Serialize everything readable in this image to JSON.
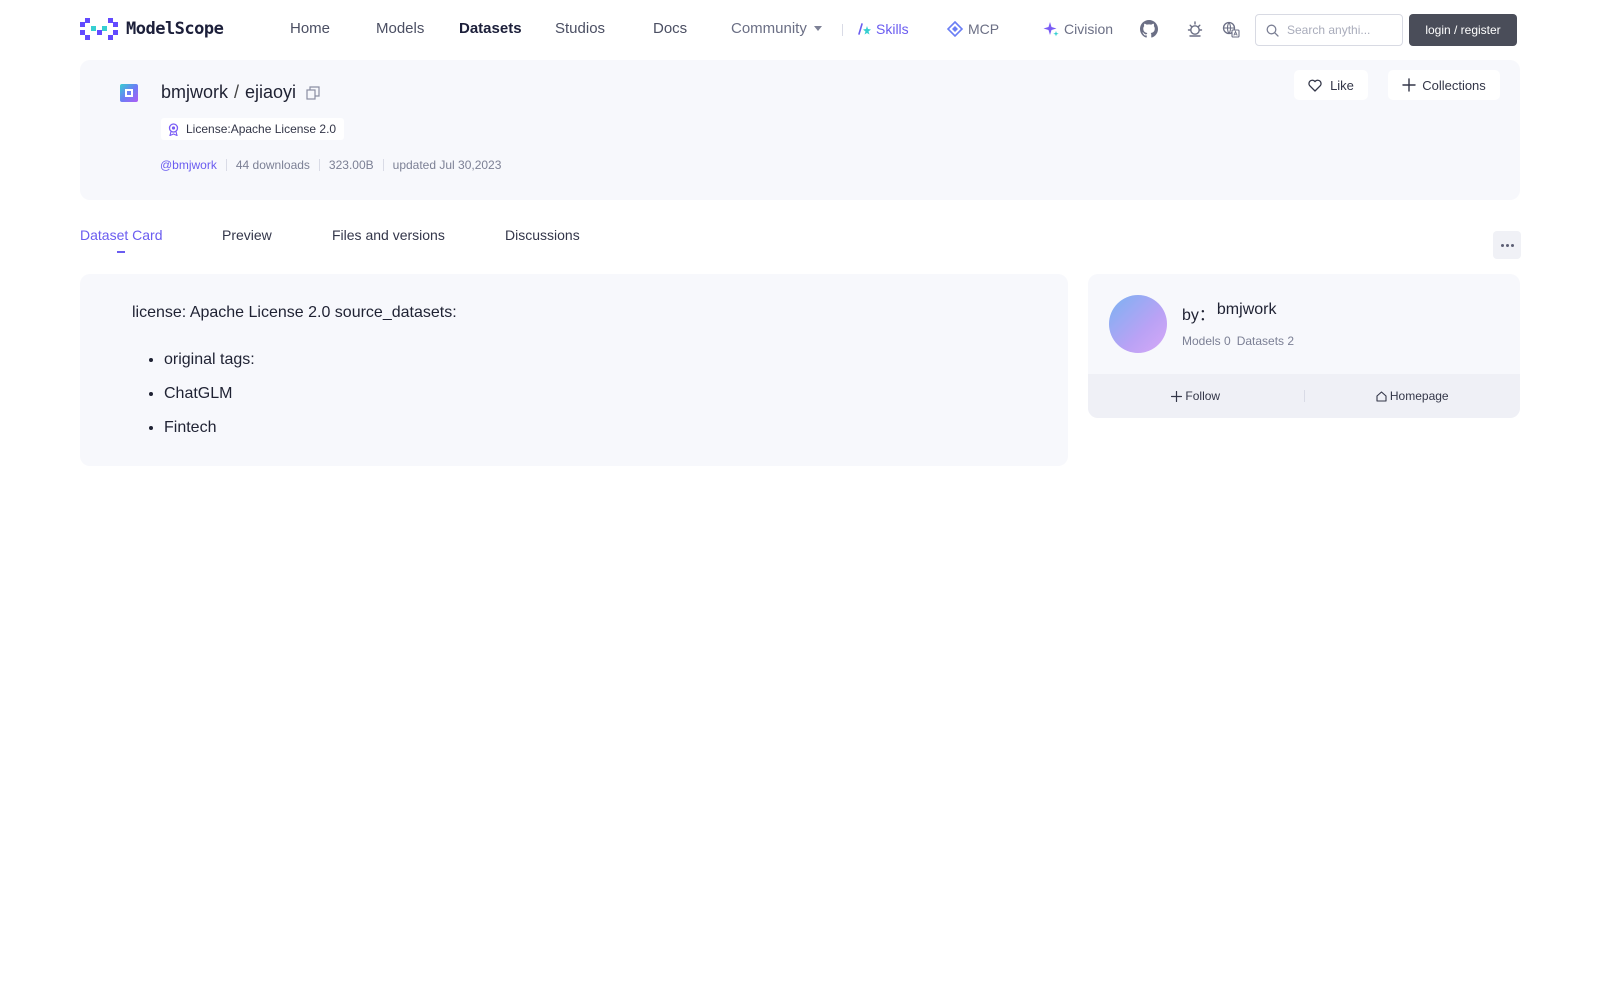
{
  "nav": {
    "logo_text": "ModelScope",
    "links": [
      "Home",
      "Models",
      "Datasets",
      "Studios",
      "Docs"
    ],
    "community_label": "Community",
    "skills_label": "Skills",
    "mcp_label": "MCP",
    "civision_label": "Civision",
    "search_placeholder": "Search anythi...",
    "login_label": "login / register"
  },
  "header": {
    "owner": "bmjwork",
    "separator": "/",
    "dataset": "ejiaoyi",
    "license_label": "License:Apache License 2.0",
    "owner_handle": "@bmjwork",
    "downloads": "44 downloads",
    "size": "323.00B",
    "updated": "updated Jul 30,2023",
    "like_label": "Like",
    "collections_label": "Collections"
  },
  "tabs": [
    "Dataset Card",
    "Preview",
    "Files and versions",
    "Discussions"
  ],
  "readme": {
    "head": "license: Apache License 2.0 source_datasets:",
    "items": [
      "original tags:",
      "ChatGLM",
      "Fintech"
    ]
  },
  "author": {
    "by_prefix": "by：",
    "name": "bmjwork",
    "models": "Models 0",
    "datasets": "Datasets 2",
    "follow_label": "Follow",
    "homepage_label": "Homepage"
  },
  "colors": {
    "accent": "#6a5cf0",
    "login_bg": "#4a4d59",
    "card_bg": "#f7f8fc"
  }
}
